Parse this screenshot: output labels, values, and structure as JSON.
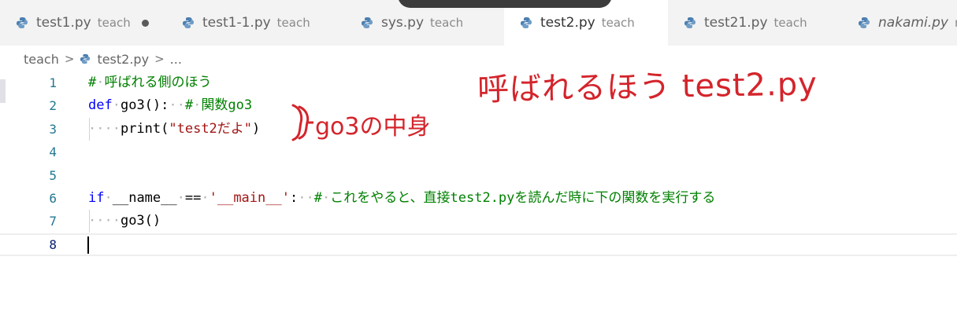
{
  "tabs": [
    {
      "name": "test1.py",
      "desc": "teach",
      "modified": true,
      "active": false,
      "italic": false
    },
    {
      "name": "test1-1.py",
      "desc": "teach",
      "modified": false,
      "active": false,
      "italic": false
    },
    {
      "name": "sys.py",
      "desc": "teach",
      "modified": false,
      "active": false,
      "italic": false
    },
    {
      "name": "test2.py",
      "desc": "teach",
      "modified": false,
      "active": true,
      "italic": false
    },
    {
      "name": "test21.py",
      "desc": "teach",
      "modified": false,
      "active": false,
      "italic": false
    },
    {
      "name": "nakami.py",
      "desc": "re",
      "modified": false,
      "active": false,
      "italic": true
    }
  ],
  "breadcrumb": {
    "folder": "teach",
    "file": "test2.py",
    "more": "..."
  },
  "editor": {
    "current_line": 8,
    "lines": [
      {
        "num": "1",
        "tokens": [
          {
            "c": "cm",
            "t": "#"
          },
          {
            "c": "ws",
            "t": "·"
          },
          {
            "c": "cm",
            "t": "呼ばれる側のほう"
          }
        ]
      },
      {
        "num": "2",
        "tokens": [
          {
            "c": "kw",
            "t": "def"
          },
          {
            "c": "ws",
            "t": "·"
          },
          {
            "c": "",
            "t": "go3():"
          },
          {
            "c": "ws",
            "t": "··"
          },
          {
            "c": "cm",
            "t": "#"
          },
          {
            "c": "ws",
            "t": "·"
          },
          {
            "c": "cm",
            "t": "関数go3"
          }
        ]
      },
      {
        "num": "3",
        "tokens": [
          {
            "c": "ws",
            "t": "····"
          },
          {
            "c": "",
            "t": "print("
          },
          {
            "c": "str",
            "t": "\"test2だよ\""
          },
          {
            "c": "",
            "t": ")"
          }
        ]
      },
      {
        "num": "4",
        "tokens": []
      },
      {
        "num": "5",
        "tokens": []
      },
      {
        "num": "6",
        "tokens": [
          {
            "c": "kw",
            "t": "if"
          },
          {
            "c": "ws",
            "t": "·"
          },
          {
            "c": "",
            "t": "__name__"
          },
          {
            "c": "ws",
            "t": "·"
          },
          {
            "c": "",
            "t": "=="
          },
          {
            "c": "ws",
            "t": "·"
          },
          {
            "c": "str",
            "t": "'__main__'"
          },
          {
            "c": "",
            "t": ":"
          },
          {
            "c": "ws",
            "t": "··"
          },
          {
            "c": "cm",
            "t": "#"
          },
          {
            "c": "ws",
            "t": "·"
          },
          {
            "c": "cm",
            "t": "これをやると、直接test2.pyを読んだ時に下の関数を実行する"
          }
        ]
      },
      {
        "num": "7",
        "tokens": [
          {
            "c": "ws",
            "t": "····"
          },
          {
            "c": "",
            "t": "go3()"
          }
        ]
      },
      {
        "num": "8",
        "tokens": []
      }
    ]
  },
  "annotations": {
    "title": "呼ばれるほう test2.py",
    "note": "go3の中身"
  },
  "colors": {
    "keyword": "#0000ff",
    "string": "#a31515",
    "comment": "#008000",
    "line_number": "#237893",
    "handwriting": "#d4242b",
    "python_icon": "#4b7fb0"
  },
  "icons": {
    "tab_file": "python-file-icon",
    "breadcrumb_file": "python-file-icon",
    "modified": "unsaved-dot-icon"
  }
}
